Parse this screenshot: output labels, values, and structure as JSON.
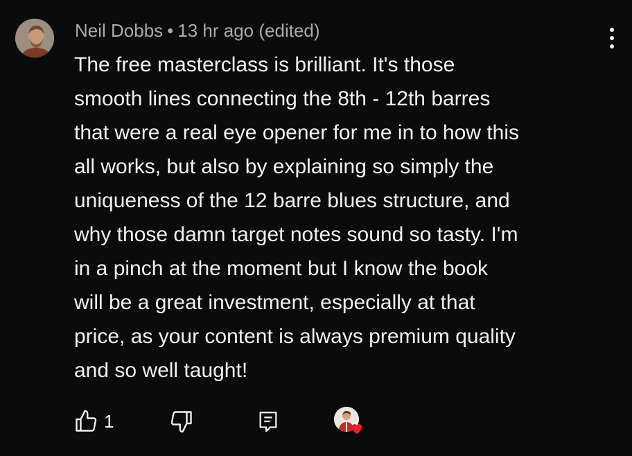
{
  "comment": {
    "author": "Neil Dobbs",
    "separator": "•",
    "timestamp": "13 hr ago (edited)",
    "lines": [
      "The free masterclass is brilliant. It's those",
      "smooth lines connecting the 8th - 12th barres",
      "that were a real eye opener for me in to how this",
      "all works, but also by explaining so simply the",
      "uniqueness of the 12 barre blues structure, and",
      "why those damn target notes sound so tasty. I'm",
      "in a pinch at the moment but I know the book",
      "will be a great investment, especially at that",
      "price, as your content is always premium quality",
      "and so well taught!"
    ],
    "like_count": "1"
  },
  "icons": {
    "avatar": "user-avatar",
    "more": "more-vertical-icon",
    "like": "thumbs-up-icon",
    "dislike": "thumbs-down-icon",
    "reply": "reply-comment-icon",
    "creator_heart": "creator-heart-badge"
  },
  "colors": {
    "background": "#0b0b0b",
    "text": "#f1f1f1",
    "meta_text": "#aaaaaa",
    "heart": "#e5202c"
  }
}
